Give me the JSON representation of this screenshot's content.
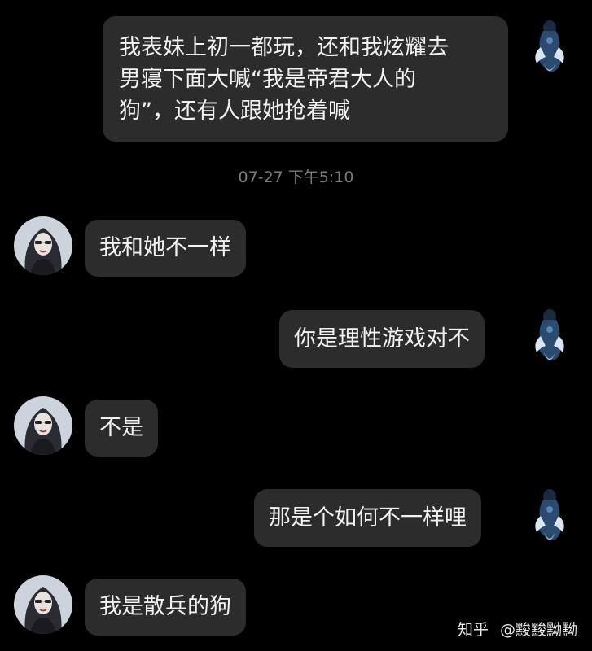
{
  "messages": [
    {
      "side": "right",
      "text_lines": [
        "我表妹上初一都玩，还和我炫耀去",
        "男寝下面大喊“我是帝君大人的",
        "狗”，还有人跟她抢着喊"
      ]
    },
    {
      "type": "time",
      "text": "07-27 下午5:10"
    },
    {
      "side": "left",
      "text": "我和她不一样"
    },
    {
      "side": "right",
      "text": "你是理性游戏对不"
    },
    {
      "side": "left",
      "text": "不是"
    },
    {
      "side": "right",
      "text": "那是个如何不一样哩"
    },
    {
      "side": "left",
      "text": "我是散兵的狗"
    }
  ],
  "watermark": {
    "site": "知乎",
    "user": "@黢黢黝黝"
  },
  "colors": {
    "background": "#000000",
    "bubble": "#2c2c2c",
    "text": "#f2f2f2",
    "timestamp": "#7a7a7a"
  },
  "icons": {
    "other_avatar": "woman-portrait-avatar",
    "self_avatar": "blue-ghost-figure-avatar"
  }
}
